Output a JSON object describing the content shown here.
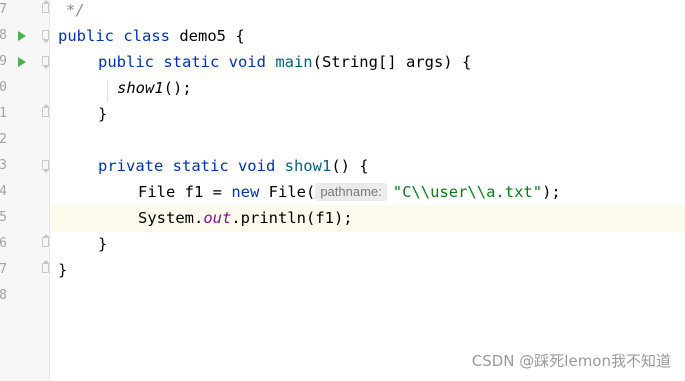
{
  "editor": {
    "line_numbers": [
      "7",
      "8",
      "9",
      "0",
      "1",
      "2",
      "3",
      "4",
      "5",
      "6",
      "7",
      "8"
    ],
    "lines": [
      {
        "segments": [
          {
            "t": "*/",
            "c": "cmt"
          }
        ]
      },
      {
        "segments": [
          {
            "t": "public class ",
            "c": "kw"
          },
          {
            "t": "demo5 {",
            "c": ""
          }
        ]
      },
      {
        "segments": [
          {
            "t": "public static void ",
            "c": "kw"
          },
          {
            "t": "main",
            "c": "fn"
          },
          {
            "t": "(String[] args) {",
            "c": ""
          }
        ]
      },
      {
        "segments": [
          {
            "t": "show1",
            "c": "it"
          },
          {
            "t": "();",
            "c": ""
          }
        ]
      },
      {
        "segments": [
          {
            "t": "}",
            "c": ""
          }
        ]
      },
      {
        "segments": []
      },
      {
        "segments": [
          {
            "t": "private static void ",
            "c": "kw"
          },
          {
            "t": "show1",
            "c": "fn"
          },
          {
            "t": "() {",
            "c": ""
          }
        ]
      },
      {
        "segments": [
          {
            "t": "File f1 = ",
            "c": ""
          },
          {
            "t": "new ",
            "c": "kw"
          },
          {
            "t": "File(",
            "c": ""
          },
          {
            "t": "pathname:",
            "c": "hint"
          },
          {
            "t": "\"C\\\\user\\\\a.txt\"",
            "c": "str"
          },
          {
            "t": ");",
            "c": ""
          }
        ]
      },
      {
        "segments": [
          {
            "t": "System.",
            "c": ""
          },
          {
            "t": "out",
            "c": "fld"
          },
          {
            "t": ".println(f1);",
            "c": ""
          }
        ]
      },
      {
        "segments": [
          {
            "t": "}",
            "c": ""
          }
        ]
      },
      {
        "segments": [
          {
            "t": "}",
            "c": ""
          }
        ]
      },
      {
        "segments": []
      }
    ]
  },
  "watermark": "CSDN @踩死lemon我不知道"
}
